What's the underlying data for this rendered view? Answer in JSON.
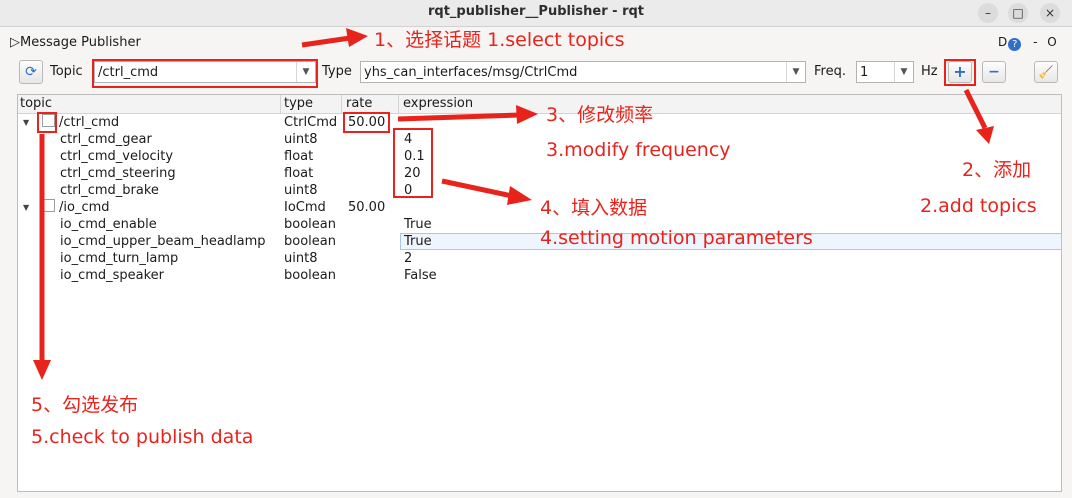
{
  "window": {
    "title": "rqt_publisher__Publisher - rqt",
    "controls": {
      "minimize": "–",
      "maximize": "□",
      "close": "×"
    }
  },
  "plugin": {
    "title_icon": "▷",
    "title": "Message Publisher",
    "d_label": "D",
    "help_label": "?",
    "minus_label": "-",
    "o_label": "O"
  },
  "toolbar": {
    "refresh_icon": "⟳",
    "topic_label": "Topic",
    "topic_value": "/ctrl_cmd",
    "type_label": "Type",
    "type_value": "yhs_can_interfaces/msg/CtrlCmd",
    "freq_label": "Freq.",
    "freq_value": "1",
    "hz_label": "Hz",
    "add_icon": "+",
    "remove_icon": "−",
    "clear_icon": "🧹",
    "combo_arrow": "▼"
  },
  "tree": {
    "headers": {
      "topic": "topic",
      "type": "type",
      "rate": "rate",
      "expression": "expression"
    },
    "expand_glyph": "▼",
    "collapse_glyph": "▼",
    "rows": [
      {
        "topic": "/ctrl_cmd",
        "type": "CtrlCmd",
        "rate": "50.00",
        "expression": ""
      },
      {
        "topic": "ctrl_cmd_gear",
        "type": "uint8",
        "rate": "",
        "expression": "4"
      },
      {
        "topic": "ctrl_cmd_velocity",
        "type": "float",
        "rate": "",
        "expression": "0.1"
      },
      {
        "topic": "ctrl_cmd_steering",
        "type": "float",
        "rate": "",
        "expression": "20"
      },
      {
        "topic": "ctrl_cmd_brake",
        "type": "uint8",
        "rate": "",
        "expression": "0"
      },
      {
        "topic": "/io_cmd",
        "type": "IoCmd",
        "rate": "50.00",
        "expression": ""
      },
      {
        "topic": "io_cmd_enable",
        "type": "boolean",
        "rate": "",
        "expression": "True"
      },
      {
        "topic": "io_cmd_upper_beam_headlamp",
        "type": "boolean",
        "rate": "",
        "expression": "True"
      },
      {
        "topic": "io_cmd_turn_lamp",
        "type": "uint8",
        "rate": "",
        "expression": "2"
      },
      {
        "topic": "io_cmd_speaker",
        "type": "boolean",
        "rate": "",
        "expression": "False"
      }
    ]
  },
  "annotations": {
    "select_topics": "1、选择话题  1.select topics",
    "add_cn": "2、添加",
    "add_en": "2.add topics",
    "freq_cn": "3、修改频率",
    "freq_en": "3.modify frequency",
    "data_cn": "4、填入数据",
    "data_en": "4.setting motion parameters",
    "check_cn": "5、勾选发布",
    "check_en": "5.check to publish data"
  },
  "colors": {
    "annotation": "#e8231c",
    "add_button": "#2f6fc9"
  }
}
